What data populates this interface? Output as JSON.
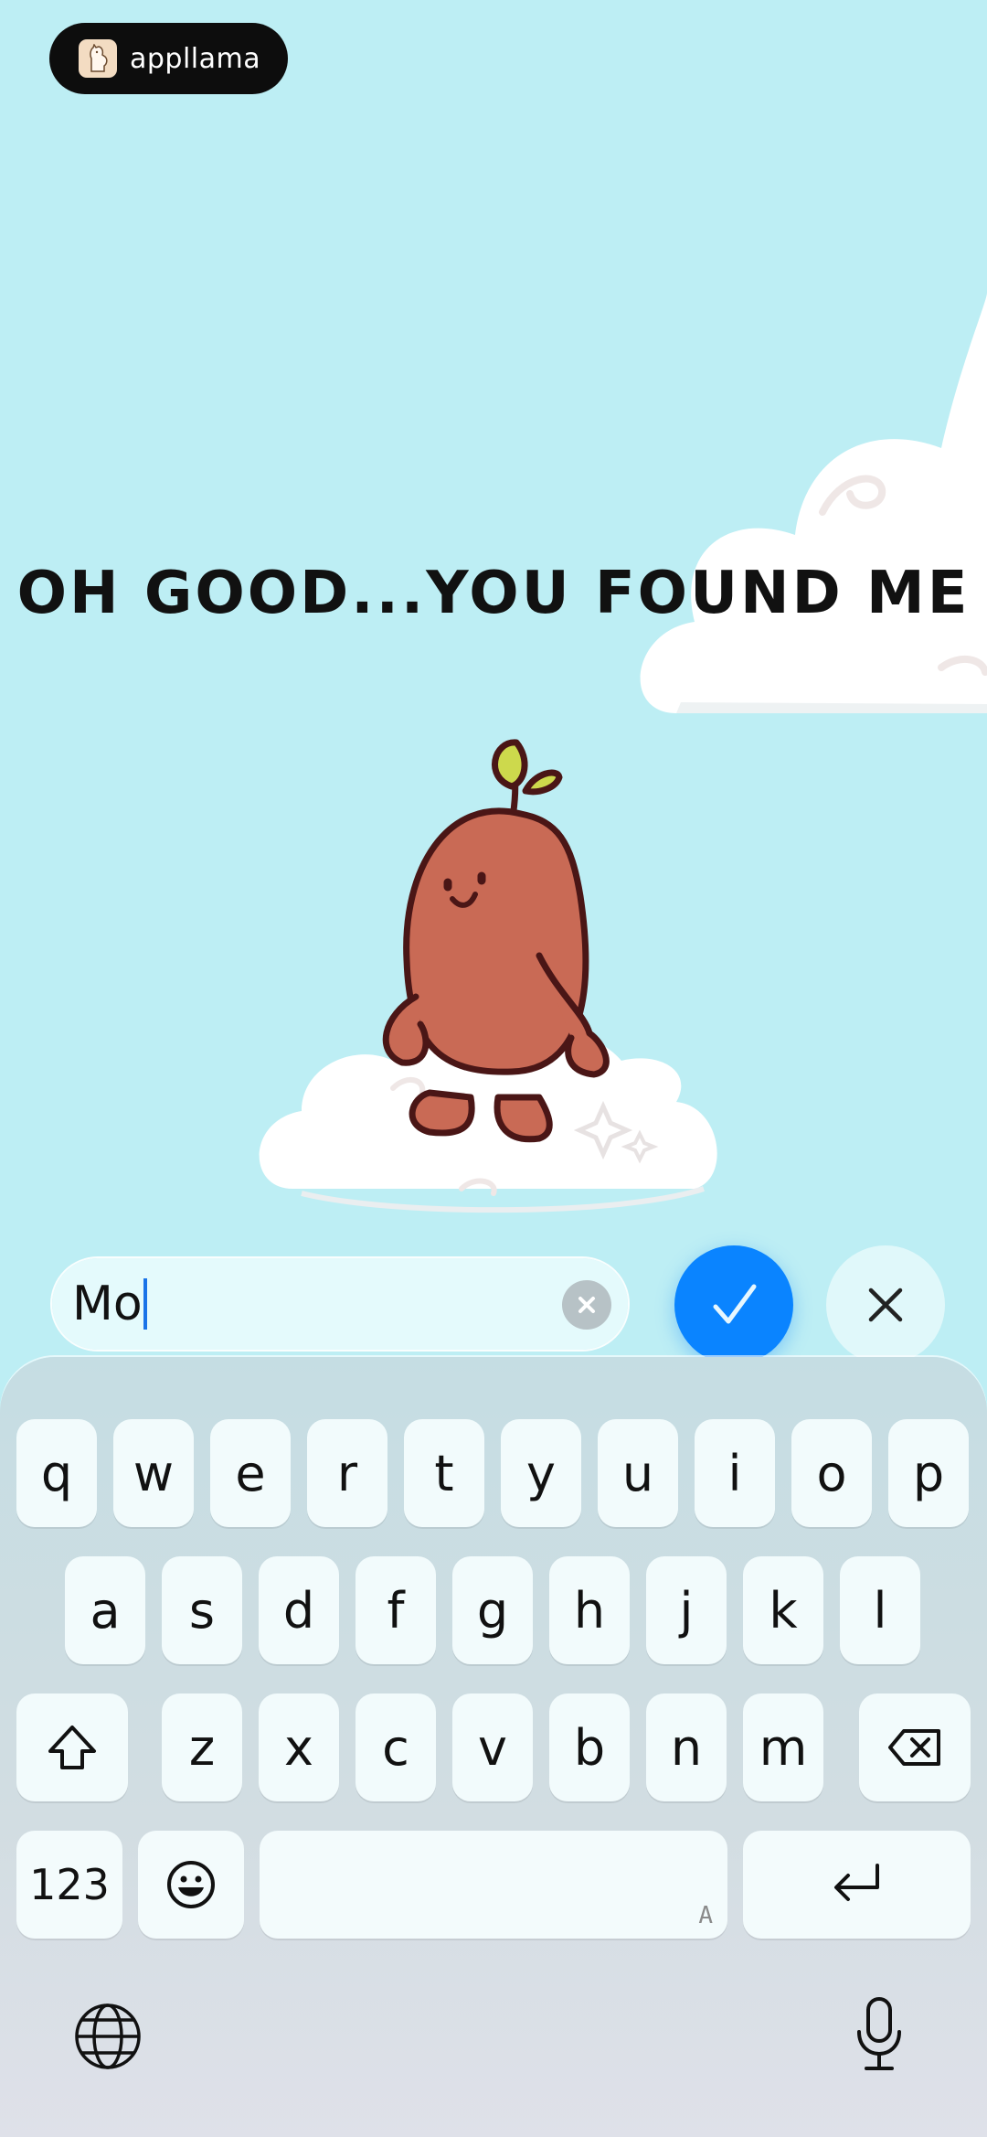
{
  "badge": {
    "brand": "appllama",
    "logo_icon": "llama-icon"
  },
  "headline": "OH GOOD...YOU FOUND ME",
  "input": {
    "value": "Mo",
    "clear_icon": "clear-icon"
  },
  "actions": {
    "confirm_icon": "checkmark-icon",
    "cancel_icon": "close-icon",
    "accent": "#0a84ff"
  },
  "keyboard": {
    "row1": [
      "q",
      "w",
      "e",
      "r",
      "t",
      "y",
      "u",
      "i",
      "o",
      "p"
    ],
    "row2": [
      "a",
      "s",
      "d",
      "f",
      "g",
      "h",
      "j",
      "k",
      "l"
    ],
    "row3": [
      "z",
      "x",
      "c",
      "v",
      "b",
      "n",
      "m"
    ],
    "numbers_label": "123",
    "space_hint": "A",
    "icons": {
      "shift": "shift-icon",
      "delete": "backspace-icon",
      "emoji": "emoji-icon",
      "return": "return-icon",
      "globe": "globe-icon",
      "mic": "microphone-icon"
    }
  }
}
